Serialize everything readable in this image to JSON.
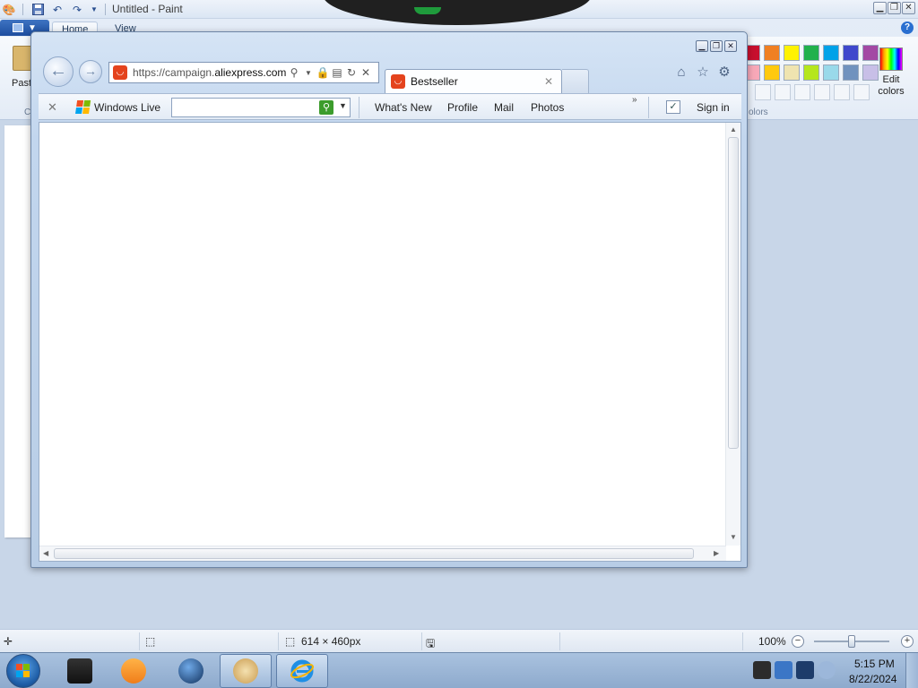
{
  "paint": {
    "title": "Untitled - Paint",
    "tabs": [
      "Home",
      "View"
    ],
    "paste_label": "Paste",
    "clipboard_label": "C",
    "colors_label": "olors",
    "edit_colors_label": "Edit colors",
    "palette_row1": [
      "#c8102e",
      "#f08022",
      "#fff200",
      "#22b14c",
      "#00a2e8",
      "#3f48cc",
      "#a349a4"
    ],
    "palette_row2": [
      "#f7a8b8",
      "#ffc90e",
      "#efe4b0",
      "#b5e61d",
      "#99d9ea",
      "#7092be",
      "#c8bfe7"
    ],
    "status": {
      "dimensions": "614 × 460px",
      "zoom": "100%"
    }
  },
  "ie": {
    "url_prefix": "https://campaign.",
    "url_domain": "aliexpress.com",
    "tab_title": "Bestseller",
    "toolbar": {
      "windows_live_label": "Windows Live",
      "search_placeholder": "",
      "links": [
        "What's New",
        "Profile",
        "Mail",
        "Photos"
      ],
      "sign_in": "Sign in"
    }
  },
  "taskbar": {
    "time": "5:15 PM",
    "date": "8/22/2024"
  }
}
